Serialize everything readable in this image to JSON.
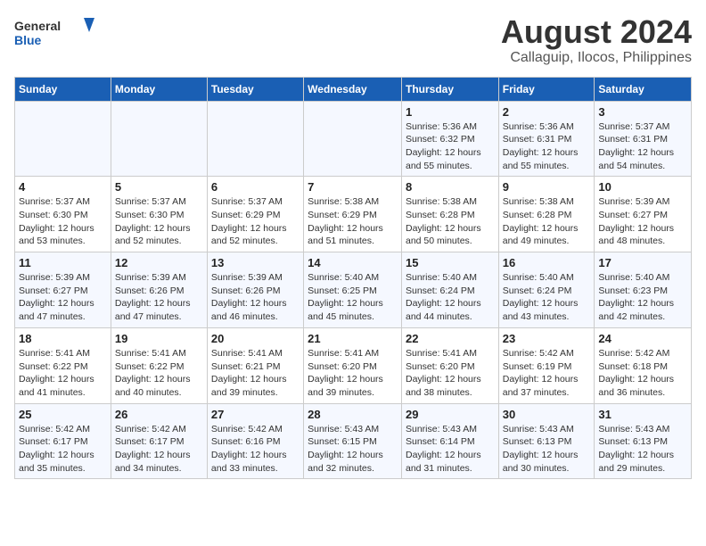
{
  "logo": {
    "line1": "General",
    "line2": "Blue"
  },
  "title": {
    "month_year": "August 2024",
    "location": "Callaguip, Ilocos, Philippines"
  },
  "days_of_week": [
    "Sunday",
    "Monday",
    "Tuesday",
    "Wednesday",
    "Thursday",
    "Friday",
    "Saturday"
  ],
  "weeks": [
    [
      {
        "day": "",
        "info": ""
      },
      {
        "day": "",
        "info": ""
      },
      {
        "day": "",
        "info": ""
      },
      {
        "day": "",
        "info": ""
      },
      {
        "day": "1",
        "info": "Sunrise: 5:36 AM\nSunset: 6:32 PM\nDaylight: 12 hours\nand 55 minutes."
      },
      {
        "day": "2",
        "info": "Sunrise: 5:36 AM\nSunset: 6:31 PM\nDaylight: 12 hours\nand 55 minutes."
      },
      {
        "day": "3",
        "info": "Sunrise: 5:37 AM\nSunset: 6:31 PM\nDaylight: 12 hours\nand 54 minutes."
      }
    ],
    [
      {
        "day": "4",
        "info": "Sunrise: 5:37 AM\nSunset: 6:30 PM\nDaylight: 12 hours\nand 53 minutes."
      },
      {
        "day": "5",
        "info": "Sunrise: 5:37 AM\nSunset: 6:30 PM\nDaylight: 12 hours\nand 52 minutes."
      },
      {
        "day": "6",
        "info": "Sunrise: 5:37 AM\nSunset: 6:29 PM\nDaylight: 12 hours\nand 52 minutes."
      },
      {
        "day": "7",
        "info": "Sunrise: 5:38 AM\nSunset: 6:29 PM\nDaylight: 12 hours\nand 51 minutes."
      },
      {
        "day": "8",
        "info": "Sunrise: 5:38 AM\nSunset: 6:28 PM\nDaylight: 12 hours\nand 50 minutes."
      },
      {
        "day": "9",
        "info": "Sunrise: 5:38 AM\nSunset: 6:28 PM\nDaylight: 12 hours\nand 49 minutes."
      },
      {
        "day": "10",
        "info": "Sunrise: 5:39 AM\nSunset: 6:27 PM\nDaylight: 12 hours\nand 48 minutes."
      }
    ],
    [
      {
        "day": "11",
        "info": "Sunrise: 5:39 AM\nSunset: 6:27 PM\nDaylight: 12 hours\nand 47 minutes."
      },
      {
        "day": "12",
        "info": "Sunrise: 5:39 AM\nSunset: 6:26 PM\nDaylight: 12 hours\nand 47 minutes."
      },
      {
        "day": "13",
        "info": "Sunrise: 5:39 AM\nSunset: 6:26 PM\nDaylight: 12 hours\nand 46 minutes."
      },
      {
        "day": "14",
        "info": "Sunrise: 5:40 AM\nSunset: 6:25 PM\nDaylight: 12 hours\nand 45 minutes."
      },
      {
        "day": "15",
        "info": "Sunrise: 5:40 AM\nSunset: 6:24 PM\nDaylight: 12 hours\nand 44 minutes."
      },
      {
        "day": "16",
        "info": "Sunrise: 5:40 AM\nSunset: 6:24 PM\nDaylight: 12 hours\nand 43 minutes."
      },
      {
        "day": "17",
        "info": "Sunrise: 5:40 AM\nSunset: 6:23 PM\nDaylight: 12 hours\nand 42 minutes."
      }
    ],
    [
      {
        "day": "18",
        "info": "Sunrise: 5:41 AM\nSunset: 6:22 PM\nDaylight: 12 hours\nand 41 minutes."
      },
      {
        "day": "19",
        "info": "Sunrise: 5:41 AM\nSunset: 6:22 PM\nDaylight: 12 hours\nand 40 minutes."
      },
      {
        "day": "20",
        "info": "Sunrise: 5:41 AM\nSunset: 6:21 PM\nDaylight: 12 hours\nand 39 minutes."
      },
      {
        "day": "21",
        "info": "Sunrise: 5:41 AM\nSunset: 6:20 PM\nDaylight: 12 hours\nand 39 minutes."
      },
      {
        "day": "22",
        "info": "Sunrise: 5:41 AM\nSunset: 6:20 PM\nDaylight: 12 hours\nand 38 minutes."
      },
      {
        "day": "23",
        "info": "Sunrise: 5:42 AM\nSunset: 6:19 PM\nDaylight: 12 hours\nand 37 minutes."
      },
      {
        "day": "24",
        "info": "Sunrise: 5:42 AM\nSunset: 6:18 PM\nDaylight: 12 hours\nand 36 minutes."
      }
    ],
    [
      {
        "day": "25",
        "info": "Sunrise: 5:42 AM\nSunset: 6:17 PM\nDaylight: 12 hours\nand 35 minutes."
      },
      {
        "day": "26",
        "info": "Sunrise: 5:42 AM\nSunset: 6:17 PM\nDaylight: 12 hours\nand 34 minutes."
      },
      {
        "day": "27",
        "info": "Sunrise: 5:42 AM\nSunset: 6:16 PM\nDaylight: 12 hours\nand 33 minutes."
      },
      {
        "day": "28",
        "info": "Sunrise: 5:43 AM\nSunset: 6:15 PM\nDaylight: 12 hours\nand 32 minutes."
      },
      {
        "day": "29",
        "info": "Sunrise: 5:43 AM\nSunset: 6:14 PM\nDaylight: 12 hours\nand 31 minutes."
      },
      {
        "day": "30",
        "info": "Sunrise: 5:43 AM\nSunset: 6:13 PM\nDaylight: 12 hours\nand 30 minutes."
      },
      {
        "day": "31",
        "info": "Sunrise: 5:43 AM\nSunset: 6:13 PM\nDaylight: 12 hours\nand 29 minutes."
      }
    ]
  ]
}
